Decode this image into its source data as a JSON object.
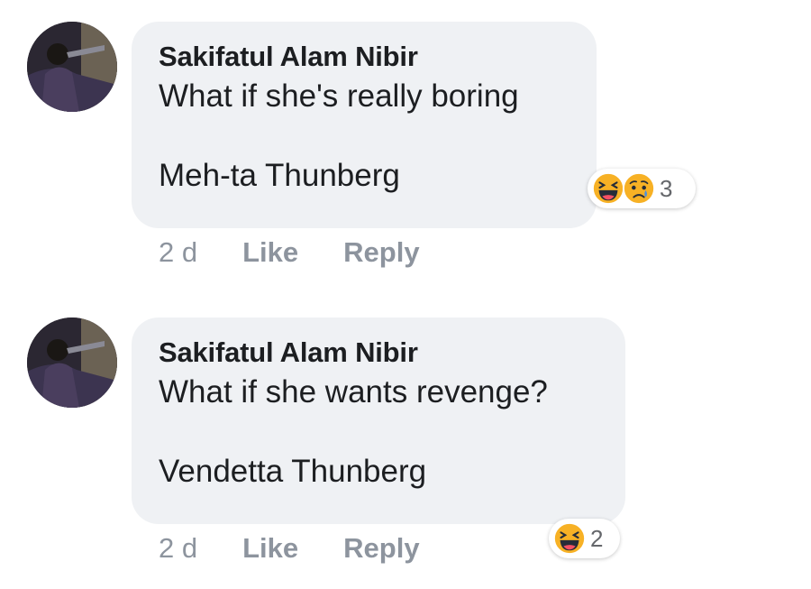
{
  "comments": [
    {
      "author": "Sakifatul Alam Nibir",
      "text": "What if she's really boring\n\nMeh-ta Thunberg",
      "time": "2 d",
      "like_label": "Like",
      "reply_label": "Reply",
      "reactions": {
        "icons": [
          "laughing-emoji",
          "sad-emoji"
        ],
        "count": "3"
      }
    },
    {
      "author": "Sakifatul Alam Nibir",
      "text": "What if she wants revenge?\n\nVendetta Thunberg",
      "time": "2 d",
      "like_label": "Like",
      "reply_label": "Reply",
      "reactions": {
        "icons": [
          "laughing-emoji"
        ],
        "count": "2"
      }
    }
  ],
  "colors": {
    "bubble": "#eff1f4",
    "text": "#1c1e21",
    "meta": "#8d949e",
    "emoji_yellow": "#f7b125"
  }
}
